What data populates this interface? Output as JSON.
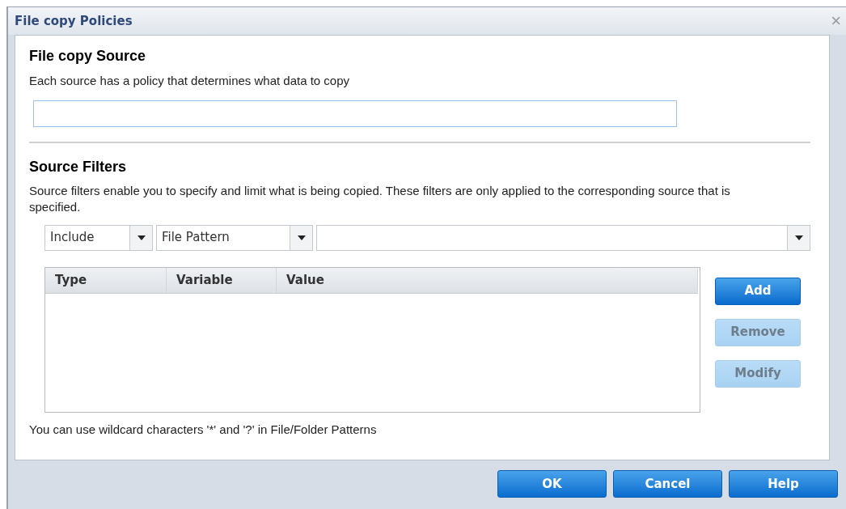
{
  "window": {
    "title": "File copy Policies",
    "close": "×"
  },
  "source": {
    "heading": "File copy Source",
    "description": "Each source has a policy that determines what data to copy"
  },
  "filters": {
    "heading": "Source Filters",
    "description": "Source filters enable you to specify and limit what is being copied. These filters are only applied to the corresponding source that is specified.",
    "selects": [
      {
        "kind": "dropdown",
        "value": "Include"
      },
      {
        "kind": "dropdown",
        "value": "File Pattern"
      },
      {
        "kind": "combo"
      }
    ],
    "table": {
      "columns": [
        "Type",
        "Variable",
        "Value"
      ]
    },
    "actions": [
      {
        "label": "Add",
        "disabled": false
      },
      {
        "label": "Remove",
        "disabled": true
      },
      {
        "label": "Modify",
        "disabled": true
      }
    ],
    "note": "You can use wildcard characters '*' and '?' in File/Folder Patterns"
  },
  "buttons": [
    {
      "label": "OK"
    },
    {
      "label": "Cancel"
    },
    {
      "label": "Help"
    }
  ]
}
